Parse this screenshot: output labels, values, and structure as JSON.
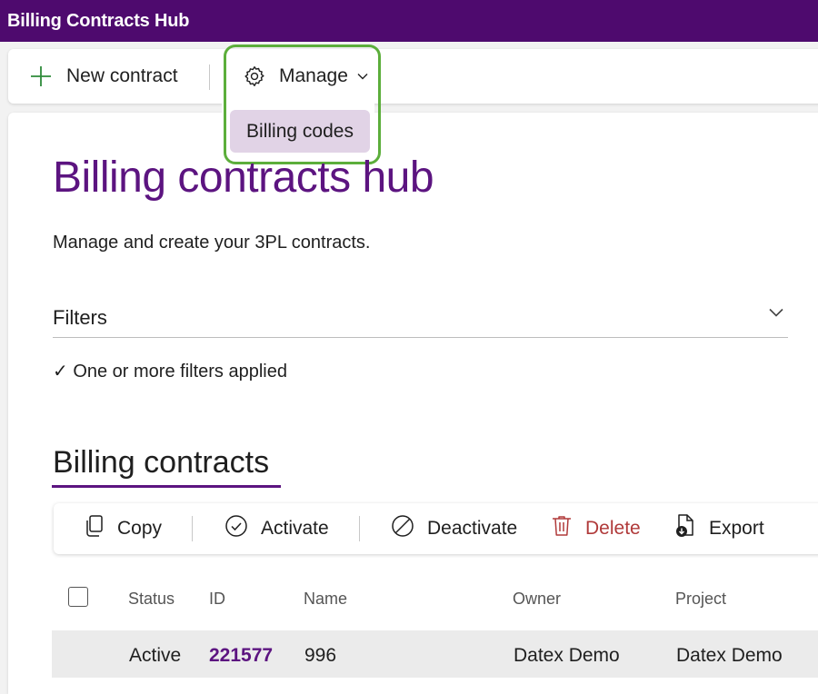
{
  "app": {
    "title": "Billing Contracts Hub"
  },
  "command_bar": {
    "new_contract_label": "New contract",
    "manage_label": "Manage",
    "manage_menu": [
      "Billing codes"
    ]
  },
  "page": {
    "title": "Billing contracts hub",
    "subtitle": "Manage and create your 3PL contracts."
  },
  "filters": {
    "label": "Filters",
    "applied_text": "✓ One or more filters applied"
  },
  "contracts": {
    "section_title": "Billing contracts",
    "toolbar": {
      "copy": "Copy",
      "activate": "Activate",
      "deactivate": "Deactivate",
      "delete": "Delete",
      "export": "Export"
    },
    "columns": [
      "Status",
      "ID",
      "Name",
      "Owner",
      "Project"
    ],
    "rows": [
      {
        "status": "Active",
        "id": "221577",
        "name": "996",
        "owner": "Datex Demo",
        "project": "Datex Demo"
      }
    ]
  },
  "colors": {
    "titlebar": "#4e0a6e",
    "accent": "#5c1480",
    "menu_item_bg": "#e1d3e6",
    "highlight": "#5cae3b",
    "delete": "#b03a3a"
  }
}
